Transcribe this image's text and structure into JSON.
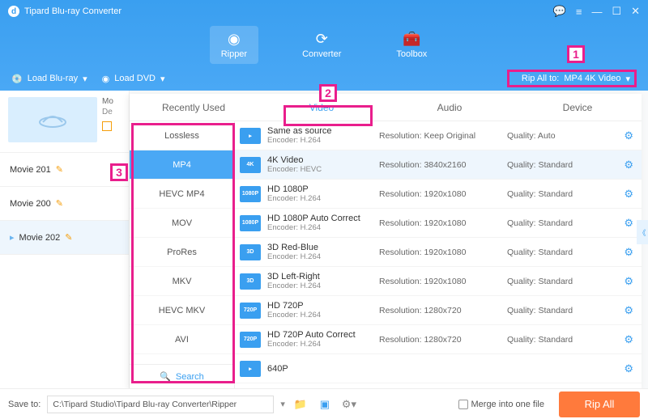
{
  "app": {
    "title": "Tipard Blu-ray Converter"
  },
  "nav": {
    "ripper": "Ripper",
    "converter": "Converter",
    "toolbox": "Toolbox"
  },
  "subbar": {
    "load_bluray": "Load Blu-ray",
    "load_dvd": "Load DVD",
    "rip_all_to_label": "Rip All to:",
    "rip_all_to_value": "MP4 4K Video"
  },
  "movies": {
    "thumb_mo": "Mo",
    "thumb_de": "De",
    "m1": "Movie 201",
    "m2": "Movie 200",
    "m3": "Movie 202"
  },
  "panel_tabs": {
    "recent": "Recently Used",
    "video": "Video",
    "audio": "Audio",
    "device": "Device"
  },
  "formats": {
    "lossless": "Lossless",
    "mp4": "MP4",
    "hevc_mp4": "HEVC MP4",
    "mov": "MOV",
    "prores": "ProRes",
    "mkv": "MKV",
    "hevc_mkv": "HEVC MKV",
    "avi": "AVI",
    "search": "Search"
  },
  "presets": [
    {
      "icon": "",
      "title": "Same as source",
      "encoder": "Encoder: H.264",
      "res": "Resolution: Keep Original",
      "q": "Quality: Auto"
    },
    {
      "icon": "4K",
      "title": "4K Video",
      "encoder": "Encoder: HEVC",
      "res": "Resolution: 3840x2160",
      "q": "Quality: Standard"
    },
    {
      "icon": "1080P",
      "title": "HD 1080P",
      "encoder": "Encoder: H.264",
      "res": "Resolution: 1920x1080",
      "q": "Quality: Standard"
    },
    {
      "icon": "1080P",
      "title": "HD 1080P Auto Correct",
      "encoder": "Encoder: H.264",
      "res": "Resolution: 1920x1080",
      "q": "Quality: Standard"
    },
    {
      "icon": "3D",
      "title": "3D Red-Blue",
      "encoder": "Encoder: H.264",
      "res": "Resolution: 1920x1080",
      "q": "Quality: Standard"
    },
    {
      "icon": "3D",
      "title": "3D Left-Right",
      "encoder": "Encoder: H.264",
      "res": "Resolution: 1920x1080",
      "q": "Quality: Standard"
    },
    {
      "icon": "720P",
      "title": "HD 720P",
      "encoder": "Encoder: H.264",
      "res": "Resolution: 1280x720",
      "q": "Quality: Standard"
    },
    {
      "icon": "720P",
      "title": "HD 720P Auto Correct",
      "encoder": "Encoder: H.264",
      "res": "Resolution: 1280x720",
      "q": "Quality: Standard"
    },
    {
      "icon": "",
      "title": "640P",
      "encoder": "",
      "res": "",
      "q": ""
    }
  ],
  "footer": {
    "save_to": "Save to:",
    "path": "C:\\Tipard Studio\\Tipard Blu-ray Converter\\Ripper",
    "merge": "Merge into one file",
    "rip_all": "Rip All"
  },
  "annotations": {
    "a1": "1",
    "a2": "2",
    "a3": "3"
  }
}
